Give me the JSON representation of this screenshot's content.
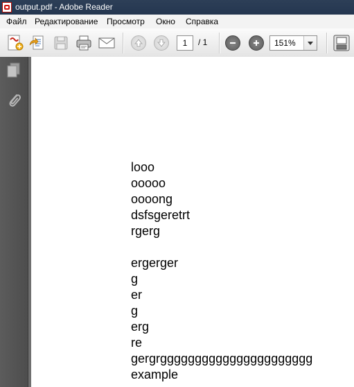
{
  "window": {
    "title": "output.pdf - Adobe Reader"
  },
  "menu": {
    "items": [
      "Файл",
      "Редактирование",
      "Просмотр",
      "Окно",
      "Справка"
    ]
  },
  "toolbar": {
    "current_page": "1",
    "page_total": "/ 1",
    "zoom": "151%",
    "icons": [
      "create-pdf-icon",
      "export-icon",
      "save-icon",
      "print-icon",
      "email-icon",
      "page-up-icon",
      "page-down-icon",
      "zoom-out-icon",
      "zoom-in-icon",
      "page-view-icon"
    ]
  },
  "nav_panel": {
    "icons": [
      "pages-icon",
      "attachments-icon"
    ]
  },
  "document": {
    "lines": [
      "looo",
      "ooooo",
      "oooong",
      "dsfsgeretrt",
      "rgerg",
      "",
      "ergerger",
      "g",
      "er",
      "g",
      "erg",
      "re",
      "gergrgggggggggggggggggggggg",
      "example"
    ]
  },
  "colors": {
    "titlebar": "#2d3f57",
    "panel": "#555555",
    "doc_bg": "#6f6f6f"
  }
}
